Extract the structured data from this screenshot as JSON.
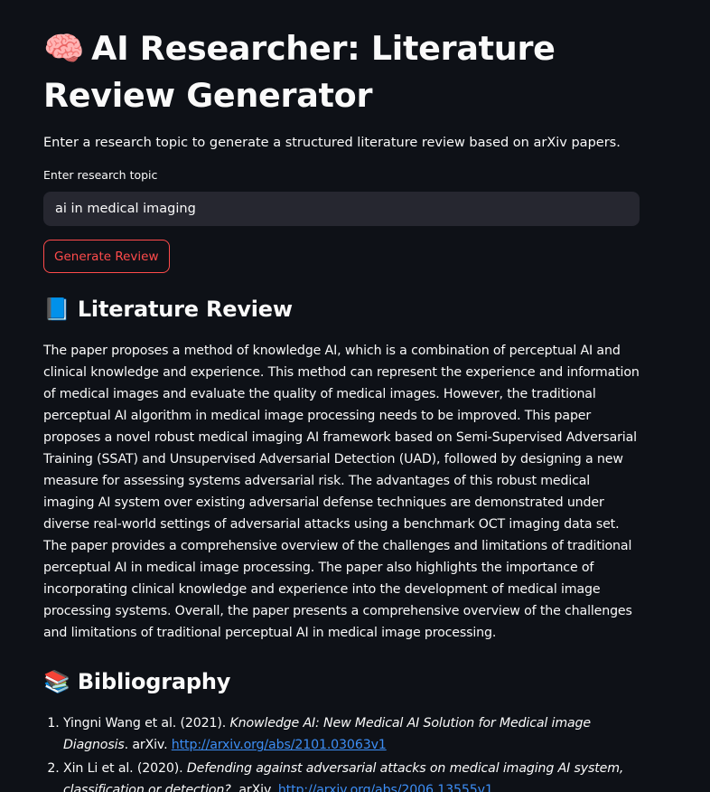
{
  "header": {
    "title_emoji": "🧠",
    "title": "AI Researcher: Literature Review Generator",
    "intro": "Enter a research topic to generate a structured literature review based on arXiv papers."
  },
  "form": {
    "input_label": "Enter research topic",
    "input_value": "ai in medical imaging",
    "button_label": "Generate Review"
  },
  "literature_review": {
    "emoji": "📘",
    "heading": "Literature Review",
    "text": "The paper proposes a method of knowledge AI, which is a combination of perceptual AI and clinical knowledge and experience. This method can represent the experience and information of medical images and evaluate the quality of medical images. However, the traditional perceptual AI algorithm in medical image processing needs to be improved. This paper proposes a novel robust medical imaging AI framework based on Semi-Supervised Adversarial Training (SSAT) and Unsupervised Adversarial Detection (UAD), followed by designing a new measure for assessing systems adversarial risk. The advantages of this robust medical imaging AI system over existing adversarial defense techniques are demonstrated under diverse real-world settings of adversarial attacks using a benchmark OCT imaging data set. The paper provides a comprehensive overview of the challenges and limitations of traditional perceptual AI in medical image processing. The paper also highlights the importance of incorporating clinical knowledge and experience into the development of medical image processing systems. Overall, the paper presents a comprehensive overview of the challenges and limitations of traditional perceptual AI in medical image processing."
  },
  "bibliography": {
    "emoji": "📚",
    "heading": "Bibliography",
    "entries": [
      {
        "authors": "Yingni Wang et al. (2021). ",
        "title": "Knowledge AI: New Medical AI Solution for Medical image Diagnosis",
        "source": ". arXiv. ",
        "link": "http://arxiv.org/abs/2101.03063v1"
      },
      {
        "authors": "Xin Li et al. (2020). ",
        "title": "Defending against adversarial attacks on medical imaging AI system, classification or detection?",
        "source": ". arXiv. ",
        "link": "http://arxiv.org/abs/2006.13555v1"
      }
    ]
  },
  "colors": {
    "background": "#0e1117",
    "text": "#fafafa",
    "input_bg": "#262730",
    "accent": "#ff4b4b",
    "link": "#3d8ef5"
  }
}
